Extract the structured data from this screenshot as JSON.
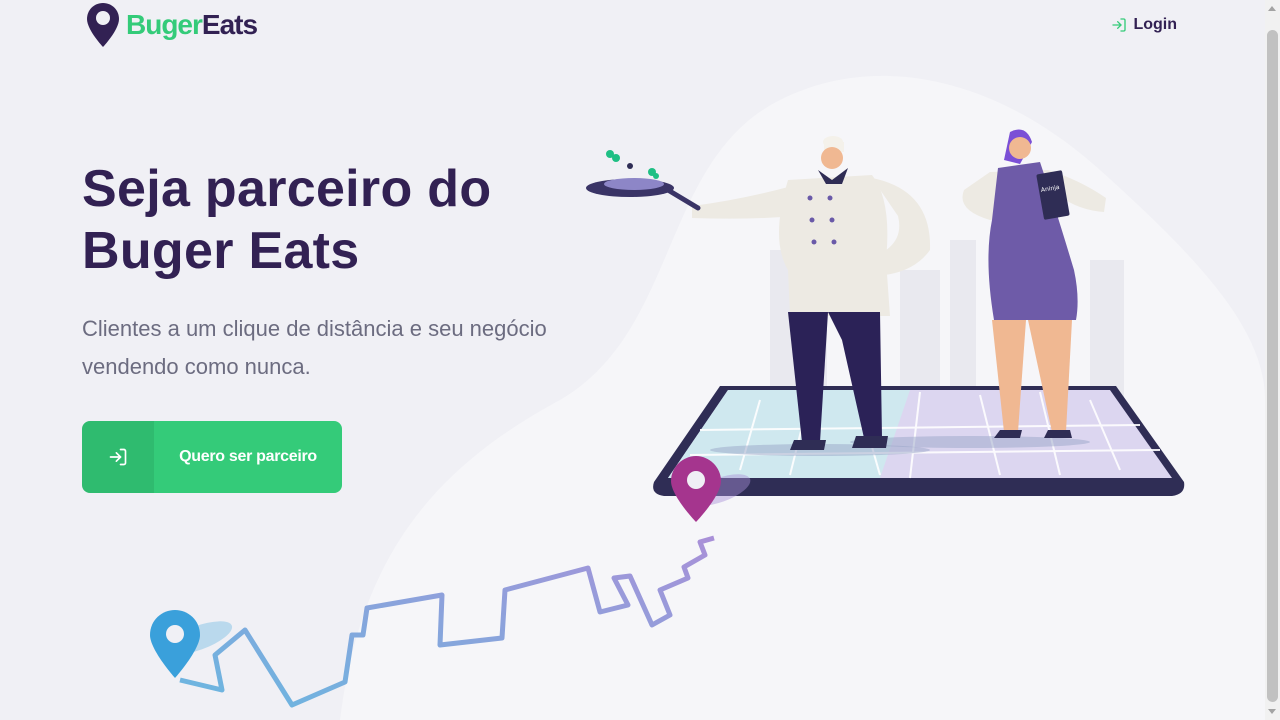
{
  "brand": {
    "name_part1": "Buger",
    "name_part2": "Eats",
    "primary_color": "#34cb79",
    "title_color": "#322153",
    "text_color": "#6c6c80",
    "background_color": "#f0f0f5"
  },
  "header": {
    "login_label": "Login",
    "login_icon": "log-in-icon"
  },
  "hero": {
    "title": "Seja parceiro do Buger Eats",
    "subtitle": "Clientes a um clique de distância e seu negócio vendendo como nunca.",
    "cta_label": "Quero ser parceiro",
    "cta_icon": "log-in-icon"
  },
  "illustration": {
    "menu_label": "Aninja"
  }
}
